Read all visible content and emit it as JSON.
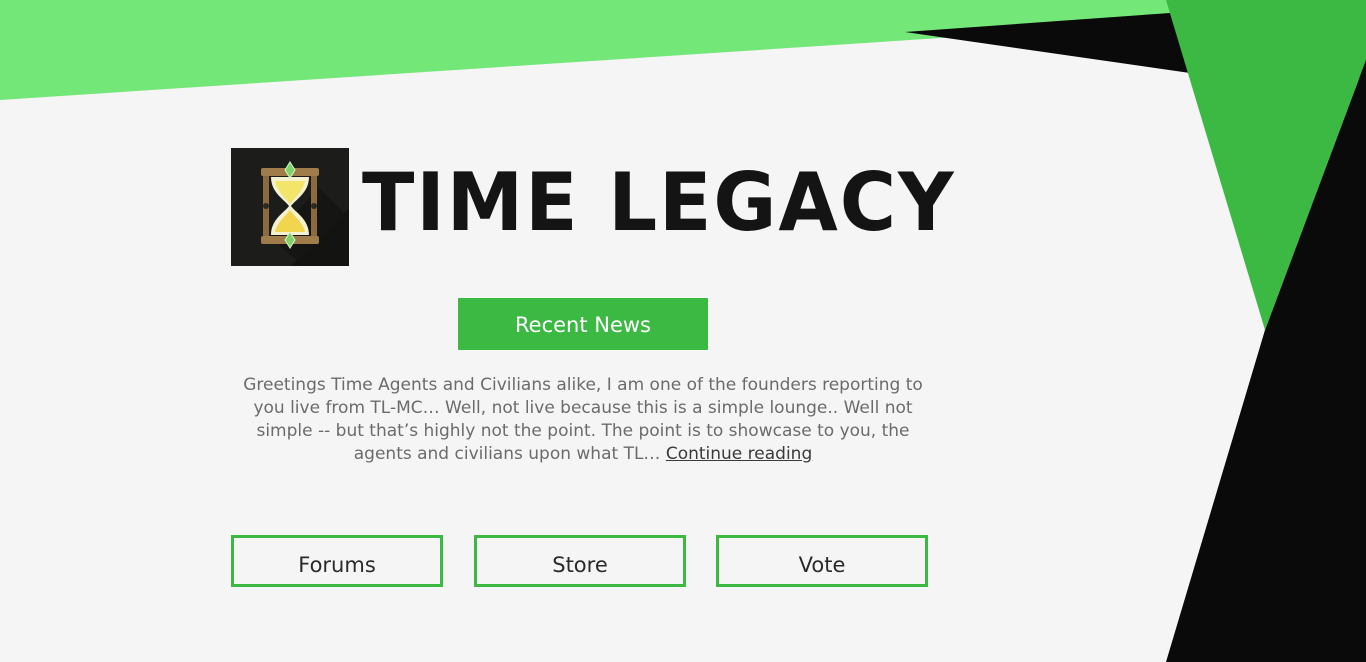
{
  "brand": {
    "name": "TIME LEGACY",
    "logo_icon": "hourglass-icon"
  },
  "news": {
    "button_label": "Recent News",
    "excerpt": "Greetings Time Agents and Civilians alike, I am one of the founders reporting to you live from TL-MC… Well, not live because this is a simple lounge.. Well not simple -- but that’s highly not the point. The point is to showcase to you, the agents and civilians upon what TL… ",
    "continue_label": "Continue reading"
  },
  "nav": {
    "forums_label": "Forums",
    "store_label": "Store",
    "vote_label": "Vote"
  },
  "colors": {
    "accent_green": "#3cb943",
    "light_green": "#73e878",
    "black": "#0a0a0a",
    "background": "#f5f5f5"
  }
}
